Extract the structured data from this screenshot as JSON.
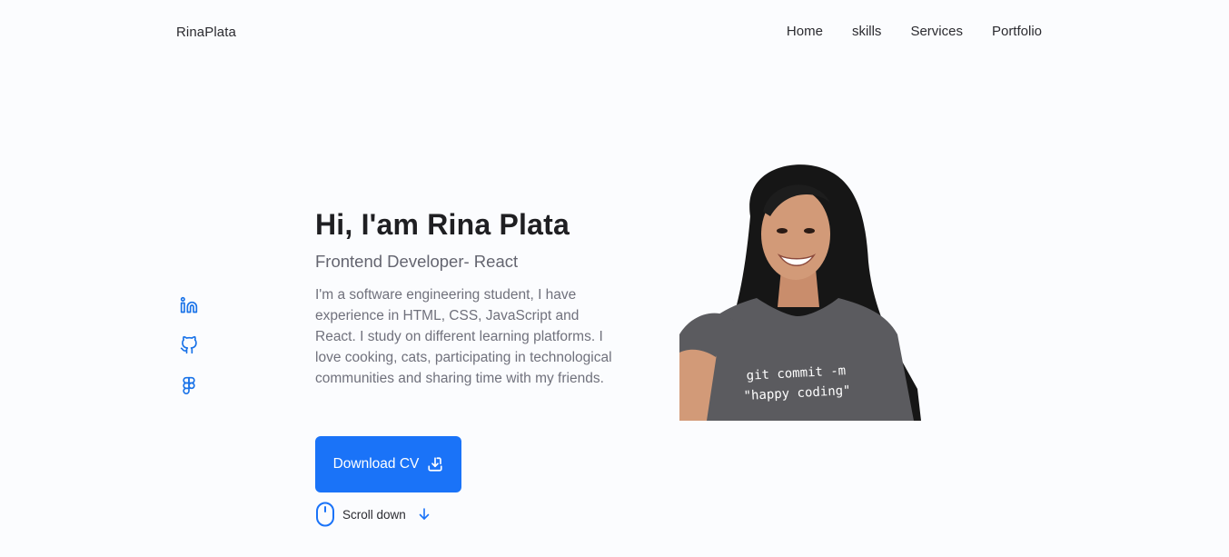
{
  "header": {
    "logo": "RinaPlata",
    "nav": [
      "Home",
      "skills",
      "Services",
      "Portfolio"
    ]
  },
  "social": [
    {
      "icon": "linkedin-icon"
    },
    {
      "icon": "github-icon"
    },
    {
      "icon": "figma-icon"
    }
  ],
  "hero": {
    "title": "Hi, I'am Rina Plata",
    "subtitle": "Frontend Developer- React",
    "description": "I'm a software engineering student, I have experience in HTML, CSS, JavaScript and React. I study on different learning platforms. I love cooking, cats, participating in technological communities and sharing time with my friends.",
    "button_label": "Download CV",
    "button_icon": "download-icon",
    "scroll_label": "Scroll down",
    "shirt_text_line1": "git commit -m",
    "shirt_text_line2": "\"happy coding\""
  },
  "colors": {
    "accent": "#1a73f8",
    "background": "#fbfcfe",
    "title": "#1f1f22",
    "text_muted": "#70717c"
  }
}
